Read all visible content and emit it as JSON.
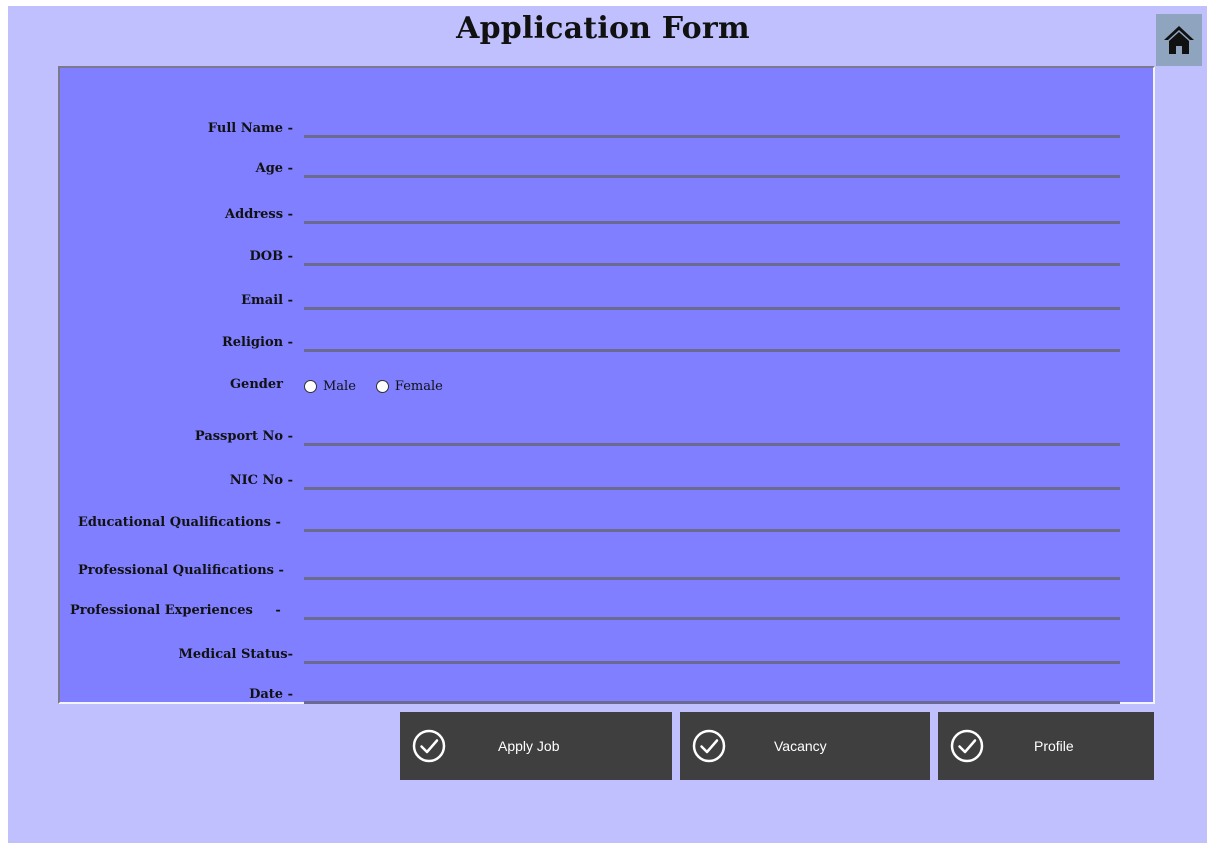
{
  "form": {
    "title": "Application Form",
    "home_icon": "home-icon",
    "fields": [
      {
        "id": "full-name",
        "label": "Full Name -",
        "value": ""
      },
      {
        "id": "age",
        "label": "Age -",
        "value": ""
      },
      {
        "id": "address",
        "label": "Address -",
        "value": ""
      },
      {
        "id": "dob",
        "label": "DOB -",
        "value": ""
      },
      {
        "id": "email",
        "label": "Email -",
        "value": ""
      },
      {
        "id": "religion",
        "label": "Religion -",
        "value": ""
      }
    ],
    "gender": {
      "label": "Gender",
      "options": [
        "Male",
        "Female"
      ],
      "selected": null
    },
    "fields2": [
      {
        "id": "passport-no",
        "label": "Passport No -",
        "value": ""
      },
      {
        "id": "nic-no",
        "label": "NIC No -",
        "value": ""
      },
      {
        "id": "educational-qualifications",
        "label": "Educational Qualifications -",
        "value": ""
      },
      {
        "id": "professional-qualifications",
        "label": "Professional Qualifications -",
        "value": ""
      },
      {
        "id": "professional-experiences",
        "label": "Professional Experiences     -",
        "value": ""
      },
      {
        "id": "medical-status",
        "label": "Medical Status-",
        "value": ""
      },
      {
        "id": "date",
        "label": "Date -",
        "value": ""
      }
    ]
  },
  "buttons": {
    "apply_job": "Apply Job",
    "vacancy": "Vacancy",
    "profile": "Profile"
  },
  "colors": {
    "background": "#c0c0ff",
    "panel": "#7f7fff",
    "button": "#3f3f3f",
    "home_button": "#8ea4bf"
  }
}
